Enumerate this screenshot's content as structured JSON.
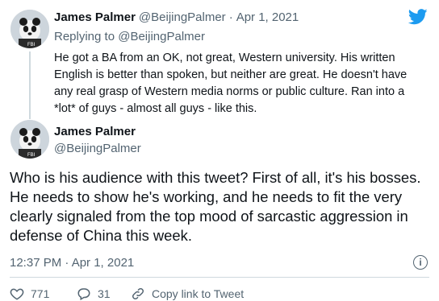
{
  "reply_tweet": {
    "author_name": "James Palmer",
    "author_handle": "@BeijingPalmer",
    "separator": "·",
    "date": "Apr 1, 2021",
    "replying_to": "Replying to @BeijingPalmer",
    "text_lines": [
      "He got a BA from an OK, not great, Western university. His written",
      "English is better than spoken, but neither are great. He doesn't have",
      "any real grasp of Western media norms or public culture. Ran into a",
      "*lot* of guys - almost all guys - like this."
    ]
  },
  "main_tweet": {
    "author_name": "James Palmer",
    "author_handle": "@BeijingPalmer",
    "text_lines": [
      "Who is his audience with this tweet? First of all, it's his bosses.",
      "He needs to show he's working, and he needs to fit the very",
      "clearly signaled from the top mood of sarcastic aggression in",
      "defense of China this week."
    ],
    "timestamp": "12:37 PM · Apr 1, 2021"
  },
  "actions": {
    "likes": "771",
    "replies": "31",
    "copy_link": "Copy link to Tweet"
  },
  "icons": {
    "brand": "twitter-bird-icon",
    "info": "info-icon",
    "like": "heart-icon",
    "reply": "reply-icon",
    "link": "link-icon"
  },
  "colors": {
    "twitter_blue": "#1d9bf0",
    "secondary_text": "#536471",
    "primary_text": "#0f1419"
  }
}
